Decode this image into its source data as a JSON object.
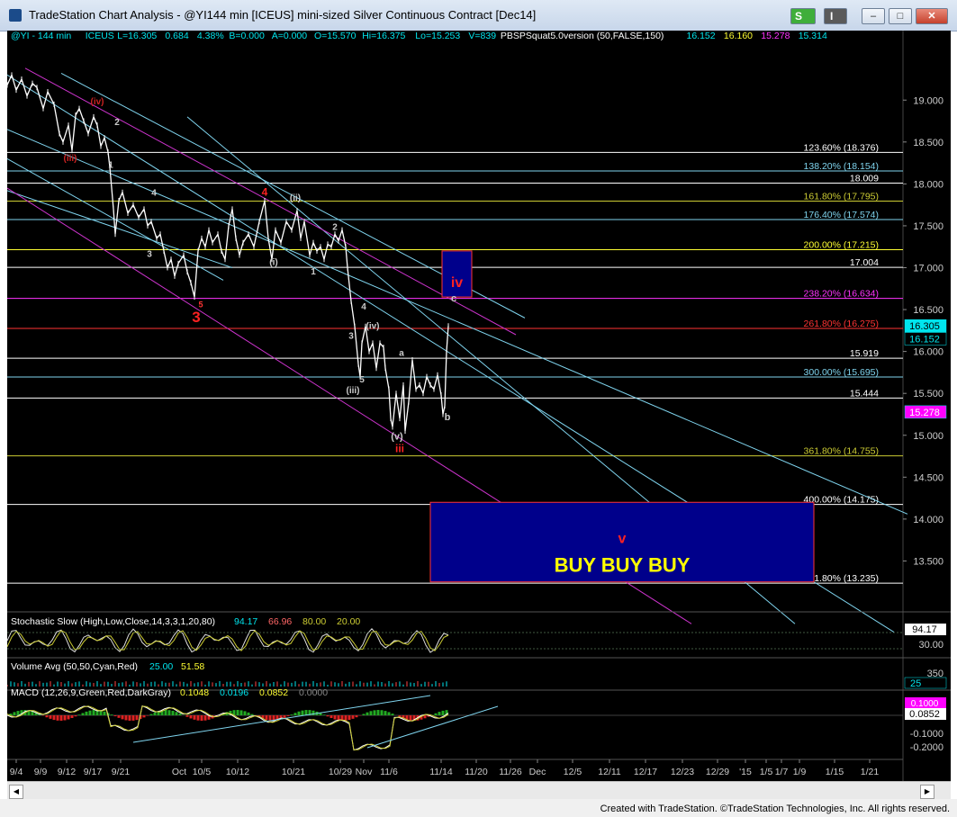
{
  "window": {
    "title": "TradeStation Chart Analysis - @YI144 min [ICEUS] mini-sized Silver Continuous Contract [Dec14]",
    "s_button": "S",
    "i_button": "I",
    "minimize": "‒",
    "maximize": "□",
    "close": "✕"
  },
  "footer": "Created with TradeStation. ©TradeStation Technologies, Inc. All rights reserved.",
  "colors": {
    "background": "#000000",
    "price": "#ffffff",
    "fib_red": "#ff3333",
    "fib_yellow": "#ffff33",
    "channel_cyan": "#7fd4ee",
    "channel_magenta": "#cc33cc",
    "buy_box": "#00008b",
    "highlight": "#ffff00"
  },
  "chart_data": {
    "type": "line",
    "symbol": "@YI",
    "interval": "144 min",
    "header": {
      "exchange": "ICEUS",
      "last": "L=16.305",
      "change": "0.684",
      "change_pct": "4.38%",
      "bid": "B=0.000",
      "ask": "A=0.000",
      "open": "O=15.570",
      "high": "Hi=16.375",
      "low": "Lo=15.253",
      "volume": "V=839",
      "study": "PBSPSquat5.0version (50,FALSE,150)",
      "study_values": [
        "16.152",
        "16.160",
        "15.278",
        "15.314"
      ]
    },
    "ylim": [
      13.0,
      19.4
    ],
    "y_ticks": [
      "19.000",
      "18.500",
      "18.000",
      "17.500",
      "17.000",
      "16.500",
      "16.000",
      "15.500",
      "15.000",
      "14.500",
      "14.000",
      "13.500"
    ],
    "x_ticks": [
      "9/4",
      "9/9",
      "9/12",
      "9/17",
      "9/21",
      "Oct",
      "10/5",
      "10/12",
      "10/21",
      "10/29",
      "Nov",
      "11/6",
      "11/14",
      "11/20",
      "11/26",
      "Dec",
      "12/5",
      "12/11",
      "12/17",
      "12/23",
      "12/29",
      "'15",
      "1/5",
      "1/7",
      "1/9",
      "1/15",
      "1/21"
    ],
    "price_series": [
      [
        0,
        19.18
      ],
      [
        5,
        19.3
      ],
      [
        10,
        19.12
      ],
      [
        16,
        19.25
      ],
      [
        22,
        19.05
      ],
      [
        28,
        19.2
      ],
      [
        33,
        19.15
      ],
      [
        40,
        18.9
      ],
      [
        45,
        19.1
      ],
      [
        52,
        18.95
      ],
      [
        58,
        18.6
      ],
      [
        62,
        18.5
      ],
      [
        68,
        18.7
      ],
      [
        72,
        18.4
      ],
      [
        76,
        18.82
      ],
      [
        80,
        18.9
      ],
      [
        85,
        18.75
      ],
      [
        90,
        18.6
      ],
      [
        96,
        18.8
      ],
      [
        100,
        18.7
      ],
      [
        104,
        18.45
      ],
      [
        108,
        18.55
      ],
      [
        112,
        18.38
      ],
      [
        114,
        18.2
      ],
      [
        118,
        17.7
      ],
      [
        120,
        17.4
      ],
      [
        124,
        17.8
      ],
      [
        128,
        17.9
      ],
      [
        134,
        17.65
      ],
      [
        140,
        17.75
      ],
      [
        146,
        17.6
      ],
      [
        152,
        17.7
      ],
      [
        156,
        17.5
      ],
      [
        160,
        17.55
      ],
      [
        166,
        17.35
      ],
      [
        170,
        17.4
      ],
      [
        174,
        17.2
      ],
      [
        178,
        17.0
      ],
      [
        182,
        17.1
      ],
      [
        186,
        16.9
      ],
      [
        190,
        17.05
      ],
      [
        196,
        17.15
      ],
      [
        200,
        16.95
      ],
      [
        204,
        16.82
      ],
      [
        208,
        16.65
      ],
      [
        212,
        17.2
      ],
      [
        216,
        17.35
      ],
      [
        220,
        17.25
      ],
      [
        224,
        17.45
      ],
      [
        228,
        17.3
      ],
      [
        234,
        17.4
      ],
      [
        238,
        17.2
      ],
      [
        242,
        17.1
      ],
      [
        246,
        17.5
      ],
      [
        250,
        17.7
      ],
      [
        254,
        17.35
      ],
      [
        258,
        17.15
      ],
      [
        262,
        17.3
      ],
      [
        268,
        17.4
      ],
      [
        274,
        17.25
      ],
      [
        280,
        17.55
      ],
      [
        286,
        17.8
      ],
      [
        290,
        17.35
      ],
      [
        294,
        17.1
      ],
      [
        298,
        17.45
      ],
      [
        304,
        17.3
      ],
      [
        310,
        17.55
      ],
      [
        316,
        17.45
      ],
      [
        322,
        17.68
      ],
      [
        326,
        17.35
      ],
      [
        330,
        17.55
      ],
      [
        336,
        17.15
      ],
      [
        340,
        17.3
      ],
      [
        344,
        17.2
      ],
      [
        348,
        17.25
      ],
      [
        352,
        17.1
      ],
      [
        356,
        17.28
      ],
      [
        360,
        17.25
      ],
      [
        364,
        17.4
      ],
      [
        368,
        17.32
      ],
      [
        372,
        17.45
      ],
      [
        376,
        17.25
      ],
      [
        378,
        17.0
      ],
      [
        382,
        16.6
      ],
      [
        386,
        16.3
      ],
      [
        390,
        15.85
      ],
      [
        392,
        15.7
      ],
      [
        394,
        16.1
      ],
      [
        398,
        16.3
      ],
      [
        402,
        16.0
      ],
      [
        406,
        16.1
      ],
      [
        410,
        15.8
      ],
      [
        414,
        16.1
      ],
      [
        418,
        16.05
      ],
      [
        420,
        15.8
      ],
      [
        424,
        15.55
      ],
      [
        426,
        15.2
      ],
      [
        428,
        15.1
      ],
      [
        432,
        15.5
      ],
      [
        436,
        15.2
      ],
      [
        440,
        15.6
      ],
      [
        442,
        15.05
      ],
      [
        446,
        15.4
      ],
      [
        450,
        15.9
      ],
      [
        454,
        15.55
      ],
      [
        458,
        15.6
      ],
      [
        462,
        15.5
      ],
      [
        466,
        15.7
      ],
      [
        470,
        15.6
      ],
      [
        474,
        15.55
      ],
      [
        478,
        15.72
      ],
      [
        482,
        15.48
      ],
      [
        484,
        15.25
      ],
      [
        486,
        15.35
      ],
      [
        488,
        16.0
      ],
      [
        490,
        16.305
      ]
    ],
    "fib_levels": [
      {
        "label": "123.60% (18.376)",
        "value": 18.376,
        "color": "#ffffff"
      },
      {
        "label": "138.20% (18.154)",
        "value": 18.154,
        "color": "#7fd4ee"
      },
      {
        "label": "18.009",
        "value": 18.009,
        "color": "#ffffff"
      },
      {
        "label": "161.80% (17.795)",
        "value": 17.795,
        "color": "#cccc33"
      },
      {
        "label": "176.40% (17.574)",
        "value": 17.574,
        "color": "#7fd4ee"
      },
      {
        "label": "200.00% (17.215)",
        "value": 17.215,
        "color": "#ffff33"
      },
      {
        "label": "17.004",
        "value": 17.004,
        "color": "#ffffff"
      },
      {
        "label": "238.20% (16.634)",
        "value": 16.634,
        "color": "#ff33ff"
      },
      {
        "label": "261.80% (16.275)",
        "value": 16.275,
        "color": "#ff3333"
      },
      {
        "label": "15.919",
        "value": 15.919,
        "color": "#ffffff"
      },
      {
        "label": "300.00% (15.695)",
        "value": 15.695,
        "color": "#7fd4ee"
      },
      {
        "label": "15.444",
        "value": 15.444,
        "color": "#ffffff"
      },
      {
        "label": "361.80% (14.755)",
        "value": 14.755,
        "color": "#cccc33"
      },
      {
        "label": "400.00% (14.175)",
        "value": 14.175,
        "color": "#ffffff"
      },
      {
        "label": "461.80% (13.235)",
        "value": 13.235,
        "color": "#ffffff"
      }
    ],
    "price_badges": [
      {
        "text": "16.305",
        "value": 16.305,
        "bg": "#00e5ee",
        "fg": "#000000"
      },
      {
        "text": "16.152",
        "value": 16.152,
        "bg": "#000000",
        "fg": "#00e5ee"
      },
      {
        "text": "15.278",
        "value": 15.278,
        "bg": "#ff00ff",
        "fg": "#ffffff"
      }
    ],
    "wave_labels": [
      {
        "text": "(iv)",
        "x": 100,
        "value": 18.95,
        "color": "#cc2222",
        "size": 10
      },
      {
        "text": "2",
        "x": 122,
        "value": 18.7,
        "color": "#cccccc",
        "size": 10
      },
      {
        "text": "(iii)",
        "x": 70,
        "value": 18.27,
        "color": "#cc2222",
        "size": 10
      },
      {
        "text": "1",
        "x": 115,
        "value": 18.19,
        "color": "#cccccc",
        "size": 10
      },
      {
        "text": "4",
        "x": 163,
        "value": 17.86,
        "color": "#cccccc",
        "size": 10
      },
      {
        "text": "3",
        "x": 158,
        "value": 17.13,
        "color": "#cccccc",
        "size": 10
      },
      {
        "text": "5",
        "x": 215,
        "value": 16.53,
        "color": "#ff3333",
        "size": 9
      },
      {
        "text": "3",
        "x": 210,
        "value": 16.35,
        "color": "#ff2222",
        "size": 17
      },
      {
        "text": "4",
        "x": 286,
        "value": 17.86,
        "color": "#ff2222",
        "size": 12
      },
      {
        "text": "(ii)",
        "x": 320,
        "value": 17.8,
        "color": "#cccccc",
        "size": 10
      },
      {
        "text": "2",
        "x": 364,
        "value": 17.45,
        "color": "#cccccc",
        "size": 10
      },
      {
        "text": "(i)",
        "x": 296,
        "value": 17.03,
        "color": "#cccccc",
        "size": 10
      },
      {
        "text": "1",
        "x": 340,
        "value": 16.92,
        "color": "#cccccc",
        "size": 10
      },
      {
        "text": "4",
        "x": 396,
        "value": 16.5,
        "color": "#cccccc",
        "size": 10
      },
      {
        "text": "(iv)",
        "x": 406,
        "value": 16.27,
        "color": "#cccccc",
        "size": 10
      },
      {
        "text": "3",
        "x": 382,
        "value": 16.15,
        "color": "#cccccc",
        "size": 10
      },
      {
        "text": "a",
        "x": 438,
        "value": 15.95,
        "color": "#cccccc",
        "size": 10
      },
      {
        "text": "5",
        "x": 394,
        "value": 15.63,
        "color": "#cccccc",
        "size": 10
      },
      {
        "text": "(iii)",
        "x": 384,
        "value": 15.5,
        "color": "#cccccc",
        "size": 10
      },
      {
        "text": "b",
        "x": 489,
        "value": 15.18,
        "color": "#cccccc",
        "size": 11
      },
      {
        "text": "(v)",
        "x": 433,
        "value": 14.95,
        "color": "#cccccc",
        "size": 11
      },
      {
        "text": "iii",
        "x": 436,
        "value": 14.8,
        "color": "#ff2222",
        "size": 12
      },
      {
        "text": "c",
        "x": 496,
        "value": 16.6,
        "color": "#cccccc",
        "size": 11
      }
    ],
    "iv_box": {
      "label": "iv",
      "x0": 483,
      "x1": 516,
      "top": 17.2,
      "bottom": 16.65
    },
    "buy_box": {
      "label": "v",
      "text": "BUY BUY BUY",
      "x0": 470,
      "x1": 896,
      "top": 14.2,
      "bottom": 13.25
    },
    "channels": [
      {
        "color": "#7fd4ee",
        "from": [
          0,
          18.65
        ],
        "to": [
          1000,
          14.06
        ]
      },
      {
        "color": "#7fd4ee",
        "from": [
          200,
          18.8
        ],
        "to": [
          875,
          12.75
        ]
      },
      {
        "color": "#7fd4ee",
        "from": [
          0,
          19.3
        ],
        "to": [
          985,
          12.65
        ]
      },
      {
        "color": "#7fd4ee",
        "from": [
          0,
          17.92
        ],
        "to": [
          250,
          17.0
        ]
      },
      {
        "color": "#7fd4ee",
        "from": [
          0,
          18.3
        ],
        "to": [
          240,
          16.85
        ]
      },
      {
        "color": "#cc33cc",
        "from": [
          0,
          17.95
        ],
        "to": [
          760,
          12.75
        ]
      },
      {
        "color": "#cc33cc",
        "from": [
          20,
          19.38
        ],
        "to": [
          565,
          16.2
        ]
      },
      {
        "color": "#7fd4ee",
        "from": [
          60,
          19.32
        ],
        "to": [
          575,
          16.4
        ]
      }
    ],
    "stochastic": {
      "label": "Stochastic Slow (High,Low,Close,14,3,3,1,20,80)",
      "values": [
        "94.17",
        "66.96",
        "80.00",
        "20.00"
      ],
      "axis": [
        "94.17",
        "30.00"
      ]
    },
    "volume": {
      "label": "Volume Avg (50,50,Cyan,Red)",
      "values": [
        "25.00",
        "51.58"
      ],
      "axis": [
        "350",
        "25"
      ]
    },
    "macd": {
      "label": "MACD (12,26,9,Green,Red,DarkGray)",
      "values": [
        "0.1048",
        "0.0196",
        "0.0852",
        "0.0000"
      ],
      "axis": [
        "0.1000",
        "0.0852",
        "-0.1000",
        "-0.2000"
      ]
    }
  }
}
